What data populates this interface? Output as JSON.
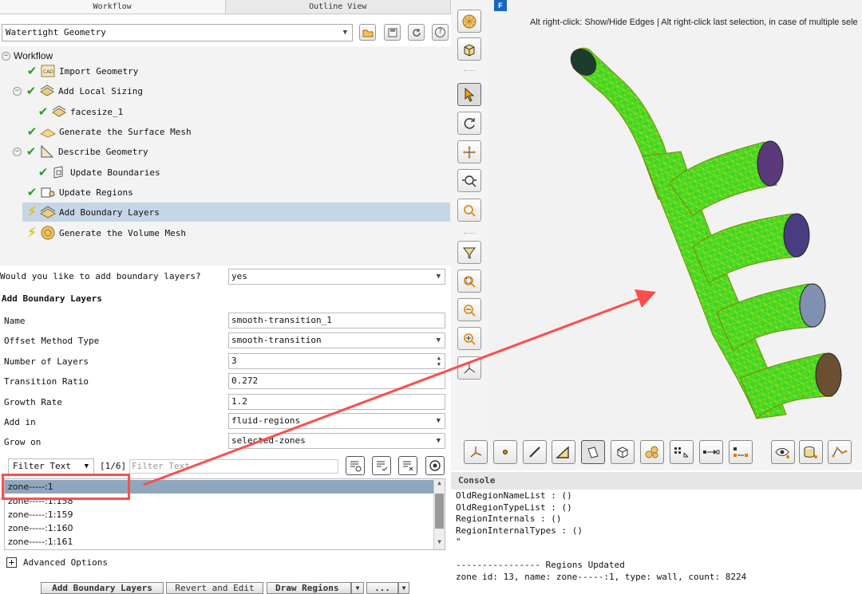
{
  "tabs": [
    "Workflow",
    "Outline View"
  ],
  "workflow_type": "Watertight Geometry",
  "tree": {
    "root": "Workflow",
    "items": [
      {
        "label": "Import Geometry"
      },
      {
        "label": "Add Local Sizing"
      },
      {
        "label": "facesize_1"
      },
      {
        "label": "Generate the Surface Mesh"
      },
      {
        "label": "Describe Geometry"
      },
      {
        "label": "Update Boundaries"
      },
      {
        "label": "Update Regions"
      },
      {
        "label": "Add Boundary Layers"
      },
      {
        "label": "Generate the Volume Mesh"
      }
    ]
  },
  "question": {
    "label": "Would you like to add boundary layers?",
    "value": "yes"
  },
  "section_title": "Add Boundary Layers",
  "fields": [
    {
      "label": "Name",
      "value": "smooth-transition_1"
    },
    {
      "label": "Offset Method Type",
      "value": "smooth-transition"
    },
    {
      "label": "Number of Layers",
      "value": "3"
    },
    {
      "label": "Transition Ratio",
      "value": "0.272"
    },
    {
      "label": "Growth Rate",
      "value": "1.2"
    },
    {
      "label": "Add in",
      "value": "fluid-regions"
    },
    {
      "label": "Grow on",
      "value": "selected-zones"
    }
  ],
  "filter": {
    "mode": "Filter Text",
    "count": "[1/6]",
    "placeholder": "Filter Text"
  },
  "zones": [
    "zone-----:1",
    "zone-----:1:158",
    "zone-----:1:159",
    "zone-----:1:160",
    "zone-----:1:161"
  ],
  "advanced_label": "Advanced Options",
  "bottom_buttons": [
    "Add Boundary Layers",
    "Revert and Edit",
    "Draw Regions",
    "..."
  ],
  "graphics": {
    "hint": "Alt right-click: Show/Hide Edges | Alt right-click last selection, in case of multiple sele",
    "logo": "F",
    "mesh_color": "#3bd62a",
    "mesh_edge_color": "#f0e000",
    "highlight_color": "#ff4d4d"
  },
  "console": {
    "title": "Console",
    "lines": [
      "OldRegionNameList : ()",
      "OldRegionTypeList : ()",
      "RegionInternals : ()",
      "RegionInternalTypes : ()",
      "\"",
      "",
      "---------------- Regions Updated",
      "zone id: 13, name: zone-----:1, type: wall, count: 8224"
    ]
  }
}
